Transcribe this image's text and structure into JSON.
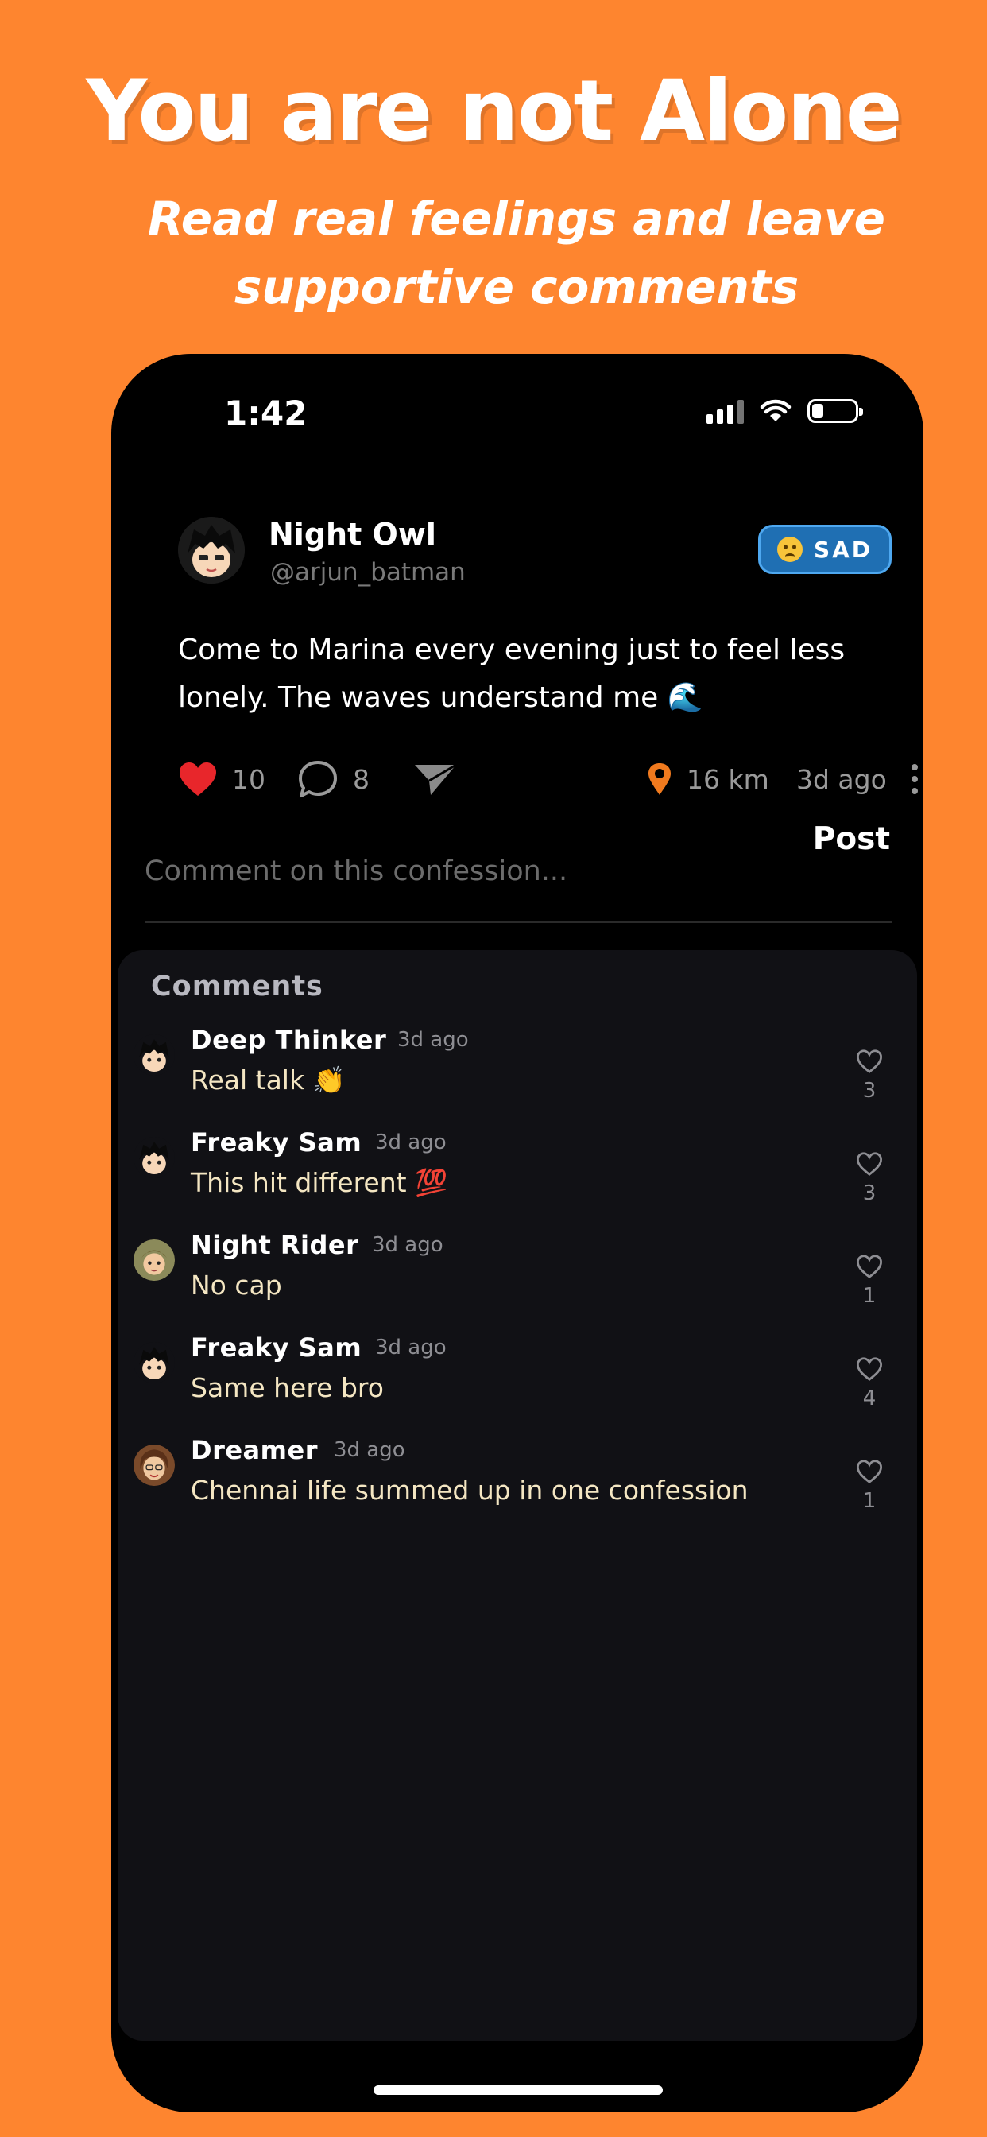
{
  "promo": {
    "headline": "You are not Alone",
    "subhead": "Read real feelings and leave supportive comments"
  },
  "status_bar": {
    "time": "1:42"
  },
  "post": {
    "author_name": "Night Owl",
    "author_handle": "@arjun_batman",
    "mood_label": "SAD",
    "text": "Come to Marina every evening just to feel less lonely. The waves understand me 🌊",
    "likes": "10",
    "comments": "8",
    "distance": "16 km",
    "time_ago": "3d ago"
  },
  "comment_input": {
    "placeholder": "Comment on this confession...",
    "post_label": "Post"
  },
  "comments_section": {
    "title": "Comments",
    "items": [
      {
        "name": "Deep Thinker",
        "time": "3d ago",
        "text": "Real talk 👏",
        "likes": "3",
        "avatar": "anime-boy"
      },
      {
        "name": "Freaky Sam",
        "time": "3d ago",
        "text": "This hit different 💯",
        "likes": "3",
        "avatar": "anime-boy"
      },
      {
        "name": "Night Rider",
        "time": "3d ago",
        "text": "No cap",
        "likes": "1",
        "avatar": "rider"
      },
      {
        "name": "Freaky Sam",
        "time": "3d ago",
        "text": "Same here bro",
        "likes": "4",
        "avatar": "anime-boy"
      },
      {
        "name": "Dreamer",
        "time": "3d ago",
        "text": "Chennai life summed up in one confession",
        "likes": "1",
        "avatar": "dreamer"
      }
    ]
  },
  "colors": {
    "background": "#FE852F",
    "accent_like": "#E8262B",
    "location": "#F07A1E",
    "mood_badge": "#1F6FB3",
    "comment_text": "#F4E6C2"
  }
}
